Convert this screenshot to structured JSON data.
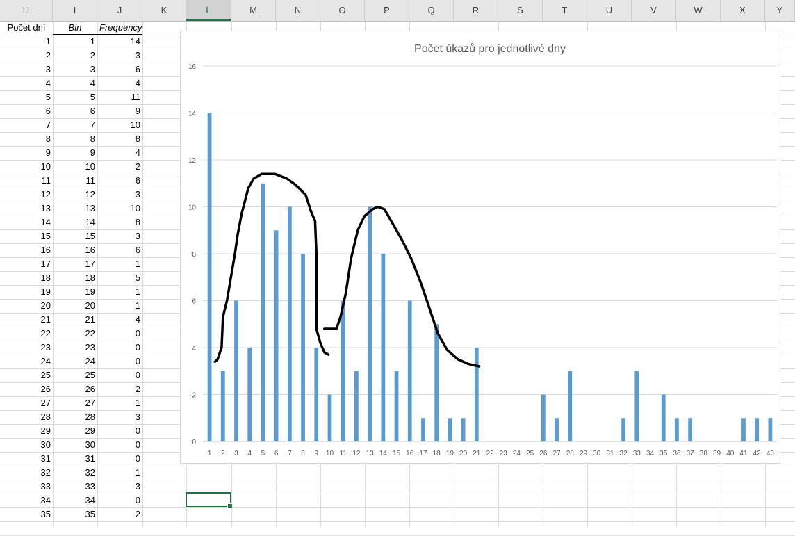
{
  "columns": [
    "H",
    "I",
    "J",
    "K",
    "L",
    "M",
    "N",
    "O",
    "P",
    "Q",
    "R",
    "S",
    "T",
    "U",
    "V",
    "W",
    "X",
    "Y"
  ],
  "selected_column": "L",
  "table": {
    "headers": {
      "h": "Počet dní",
      "i": "Bin",
      "j": "Frequency"
    },
    "rows": [
      {
        "h": "1",
        "i": "1",
        "j": "14"
      },
      {
        "h": "2",
        "i": "2",
        "j": "3"
      },
      {
        "h": "3",
        "i": "3",
        "j": "6"
      },
      {
        "h": "4",
        "i": "4",
        "j": "4"
      },
      {
        "h": "5",
        "i": "5",
        "j": "11"
      },
      {
        "h": "6",
        "i": "6",
        "j": "9"
      },
      {
        "h": "7",
        "i": "7",
        "j": "10"
      },
      {
        "h": "8",
        "i": "8",
        "j": "8"
      },
      {
        "h": "9",
        "i": "9",
        "j": "4"
      },
      {
        "h": "10",
        "i": "10",
        "j": "2"
      },
      {
        "h": "11",
        "i": "11",
        "j": "6"
      },
      {
        "h": "12",
        "i": "12",
        "j": "3"
      },
      {
        "h": "13",
        "i": "13",
        "j": "10"
      },
      {
        "h": "14",
        "i": "14",
        "j": "8"
      },
      {
        "h": "15",
        "i": "15",
        "j": "3"
      },
      {
        "h": "16",
        "i": "16",
        "j": "6"
      },
      {
        "h": "17",
        "i": "17",
        "j": "1"
      },
      {
        "h": "18",
        "i": "18",
        "j": "5"
      },
      {
        "h": "19",
        "i": "19",
        "j": "1"
      },
      {
        "h": "20",
        "i": "20",
        "j": "1"
      },
      {
        "h": "21",
        "i": "21",
        "j": "4"
      },
      {
        "h": "22",
        "i": "22",
        "j": "0"
      },
      {
        "h": "23",
        "i": "23",
        "j": "0"
      },
      {
        "h": "24",
        "i": "24",
        "j": "0"
      },
      {
        "h": "25",
        "i": "25",
        "j": "0"
      },
      {
        "h": "26",
        "i": "26",
        "j": "2"
      },
      {
        "h": "27",
        "i": "27",
        "j": "1"
      },
      {
        "h": "28",
        "i": "28",
        "j": "3"
      },
      {
        "h": "29",
        "i": "29",
        "j": "0"
      },
      {
        "h": "30",
        "i": "30",
        "j": "0"
      },
      {
        "h": "31",
        "i": "31",
        "j": "0"
      },
      {
        "h": "32",
        "i": "32",
        "j": "1"
      },
      {
        "h": "33",
        "i": "33",
        "j": "3"
      },
      {
        "h": "34",
        "i": "34",
        "j": "0"
      },
      {
        "h": "35",
        "i": "35",
        "j": "2"
      }
    ]
  },
  "chart_data": {
    "type": "bar",
    "title": "Počet úkazů pro jednotlivé dny",
    "xlabel": "",
    "ylabel": "",
    "ylim": [
      0,
      16
    ],
    "yticks": [
      0,
      2,
      4,
      6,
      8,
      10,
      12,
      14,
      16
    ],
    "grid": true,
    "legend": "none",
    "color": "#5b9bd5",
    "categories": [
      "1",
      "2",
      "3",
      "4",
      "5",
      "6",
      "7",
      "8",
      "9",
      "10",
      "11",
      "12",
      "13",
      "14",
      "15",
      "16",
      "17",
      "18",
      "19",
      "20",
      "21",
      "22",
      "23",
      "24",
      "25",
      "26",
      "27",
      "28",
      "29",
      "30",
      "31",
      "32",
      "33",
      "34",
      "35",
      "36",
      "37",
      "38",
      "39",
      "40",
      "41",
      "42",
      "43"
    ],
    "values": [
      14,
      3,
      6,
      4,
      11,
      9,
      10,
      8,
      4,
      2,
      6,
      3,
      10,
      8,
      3,
      6,
      1,
      5,
      1,
      1,
      4,
      0,
      0,
      0,
      0,
      2,
      1,
      3,
      0,
      0,
      0,
      1,
      3,
      0,
      2,
      1,
      1,
      0,
      0,
      0,
      1,
      1,
      1
    ],
    "annotations": [
      {
        "kind": "hand-drawn curve",
        "color": "#000000",
        "points": [
          [
            1.4,
            3.4
          ],
          [
            1.6,
            3.5
          ],
          [
            1.9,
            4
          ],
          [
            2,
            5.3
          ],
          [
            2.3,
            6
          ],
          [
            2.6,
            7
          ],
          [
            2.9,
            8
          ],
          [
            3.1,
            8.8
          ],
          [
            3.4,
            9.7
          ],
          [
            3.9,
            10.8
          ],
          [
            4.3,
            11.2
          ],
          [
            4.9,
            11.4
          ],
          [
            5.9,
            11.4
          ],
          [
            6.8,
            11.2
          ],
          [
            7.3,
            11
          ],
          [
            7.7,
            10.8
          ],
          [
            8.2,
            10.5
          ],
          [
            8.6,
            9.8
          ],
          [
            8.9,
            9.4
          ],
          [
            9,
            8
          ],
          [
            9,
            4.8
          ],
          [
            9.3,
            4.2
          ],
          [
            9.6,
            3.8
          ],
          [
            9.9,
            3.7
          ]
        ]
      },
      {
        "kind": "hand-drawn curve",
        "color": "#000000",
        "points": [
          [
            9.6,
            4.8
          ],
          [
            10.5,
            4.8
          ],
          [
            10.8,
            5.3
          ],
          [
            11.2,
            6.3
          ],
          [
            11.6,
            7.8
          ],
          [
            12.1,
            9
          ],
          [
            12.6,
            9.6
          ],
          [
            13.2,
            9.9
          ],
          [
            13.6,
            10
          ],
          [
            14.1,
            9.9
          ],
          [
            14.5,
            9.5
          ],
          [
            14.9,
            9.1
          ],
          [
            15.4,
            8.6
          ],
          [
            16.1,
            7.8
          ],
          [
            16.8,
            6.8
          ],
          [
            17.4,
            5.8
          ],
          [
            18.1,
            4.6
          ],
          [
            18.8,
            3.9
          ],
          [
            19.6,
            3.5
          ],
          [
            20.4,
            3.3
          ],
          [
            21.2,
            3.2
          ]
        ]
      }
    ]
  }
}
